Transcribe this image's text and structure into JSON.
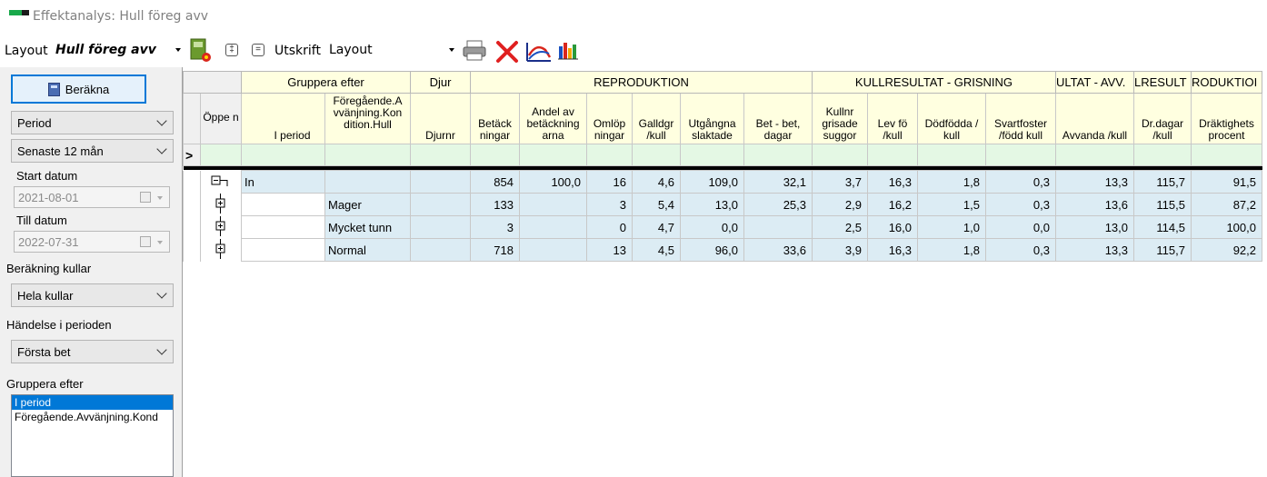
{
  "window": {
    "title": "Effektanalys: Hull föreg avv"
  },
  "toolbar": {
    "layout_label": "Layout",
    "layout_value": "Hull föreg avv",
    "expand_label": "‡",
    "collapse_label": "=",
    "print_label": "Utskrift",
    "print_layout_value": "Layout"
  },
  "sidebar": {
    "calc_button": "Beräkna",
    "period_select": "Period",
    "range_select": "Senaste 12 mån",
    "start_label": "Start datum",
    "start_value": "2021-08-01",
    "end_label": "Till datum",
    "end_value": "2022-07-31",
    "calc_litters_label": "Beräkning kullar",
    "calc_litters_value": "Hela kullar",
    "event_label": "Händelse i perioden",
    "event_value": "Första bet",
    "group_label": "Gruppera efter",
    "group_items": [
      "I period",
      "Föregående.Avvänjning.Kond"
    ]
  },
  "grid": {
    "bands": {
      "group": "Gruppera efter",
      "animal": "Djur",
      "repro": "REPRODUKTION",
      "litter": "KULLRESULTAT - GRISNING",
      "wean": "ULTAT - AVV.",
      "litter2": "LRESULT",
      "prod": "RODUKTIOI"
    },
    "columns": {
      "open": "Öppe n",
      "period": "I period",
      "prev": "Föregående.A vvänjning.Kon dition.Hull",
      "animal_no": "Djurnr",
      "c1": "Betäck ningar",
      "c2": "Andel av betäckning arna",
      "c3": "Omlöp ningar",
      "c4": "Galldgr /kull",
      "c5": "Utgångna slaktade",
      "c6": "Bet - bet, dagar",
      "c7": "Kullnr grisade suggor",
      "c8": "Lev fö /kull",
      "c9": "Dödfödda / kull",
      "c10": "Svartfoster /född kull",
      "c11": "Avvanda /kull",
      "c12": "Dr.dagar /kull",
      "c13": "Dräktighets procent"
    },
    "filter_indicator": ">",
    "rows": [
      {
        "period": "In",
        "group": "",
        "v": [
          "854",
          "100,0",
          "16",
          "4,6",
          "109,0",
          "32,1",
          "3,7",
          "16,3",
          "1,8",
          "0,3",
          "13,3",
          "115,7",
          "91,5"
        ]
      },
      {
        "period": "",
        "group": "Mager",
        "v": [
          "133",
          "",
          "3",
          "5,4",
          "13,0",
          "25,3",
          "2,9",
          "16,2",
          "1,5",
          "0,3",
          "13,6",
          "115,5",
          "87,2"
        ]
      },
      {
        "period": "",
        "group": "Mycket tunn",
        "v": [
          "3",
          "",
          "0",
          "4,7",
          "0,0",
          "",
          "2,5",
          "16,0",
          "1,0",
          "0,0",
          "13,0",
          "114,5",
          "100,0"
        ]
      },
      {
        "period": "",
        "group": "Normal",
        "v": [
          "718",
          "",
          "13",
          "4,5",
          "96,0",
          "33,6",
          "3,9",
          "16,3",
          "1,8",
          "0,3",
          "13,3",
          "115,7",
          "92,2"
        ]
      }
    ]
  }
}
